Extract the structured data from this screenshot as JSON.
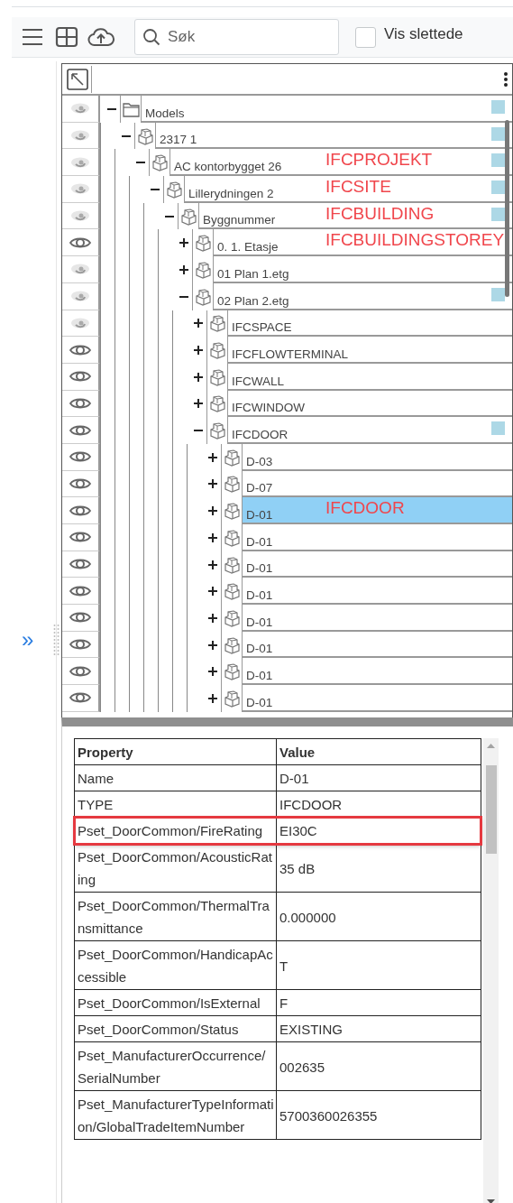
{
  "toolbar": {
    "search": {
      "placeholder": "Søk"
    },
    "show_deleted": {
      "label": "Vis slettede",
      "checked": false
    }
  },
  "sidebar": {
    "expand_glyph": "»"
  },
  "tree": {
    "nodes": [
      {
        "label": "Models",
        "kind": "folder",
        "dimmed": true,
        "expanded": true,
        "marker": true,
        "selected": false,
        "children": [
          {
            "label": "2317  1",
            "kind": "model",
            "dimmed": true,
            "expanded": true,
            "marker": true,
            "selected": false,
            "children": [
              {
                "label": "AC kontorbygget 26",
                "kind": "model",
                "dimmed": true,
                "expanded": true,
                "marker": true,
                "selected": false,
                "annotation": "IFCPROJEKT",
                "children": [
                  {
                    "label": "Lillerydningen 2",
                    "kind": "model",
                    "dimmed": true,
                    "expanded": true,
                    "marker": true,
                    "selected": false,
                    "annotation": "IFCSITE",
                    "children": [
                      {
                        "label": "Byggnummer",
                        "kind": "model",
                        "dimmed": true,
                        "expanded": true,
                        "marker": true,
                        "selected": false,
                        "annotation": "IFCBUILDING",
                        "children": [
                          {
                            "label": "0. 1. Etasje",
                            "kind": "model",
                            "dimmed": false,
                            "expanded": false,
                            "marker": false,
                            "selected": false,
                            "annotation": "IFCBUILDINGSTOREY"
                          },
                          {
                            "label": "01 Plan 1.etg",
                            "kind": "model",
                            "dimmed": true,
                            "expanded": false,
                            "marker": false,
                            "selected": false
                          },
                          {
                            "label": "02 Plan 2.etg",
                            "kind": "model",
                            "dimmed": true,
                            "expanded": true,
                            "marker": true,
                            "selected": false,
                            "children": [
                              {
                                "label": "IFCSPACE",
                                "kind": "model",
                                "dimmed": true,
                                "expanded": false,
                                "marker": false,
                                "selected": false
                              },
                              {
                                "label": "IFCFLOWTERMINAL",
                                "kind": "model",
                                "dimmed": false,
                                "expanded": false,
                                "marker": false,
                                "selected": false
                              },
                              {
                                "label": "IFCWALL",
                                "kind": "model",
                                "dimmed": false,
                                "expanded": false,
                                "marker": false,
                                "selected": false
                              },
                              {
                                "label": "IFCWINDOW",
                                "kind": "model",
                                "dimmed": false,
                                "expanded": false,
                                "marker": false,
                                "selected": false
                              },
                              {
                                "label": "IFCDOOR",
                                "kind": "model",
                                "dimmed": false,
                                "expanded": true,
                                "marker": true,
                                "selected": false,
                                "children": [
                                  {
                                    "label": "D-03",
                                    "kind": "model",
                                    "dimmed": false,
                                    "expanded": false,
                                    "marker": false,
                                    "selected": false
                                  },
                                  {
                                    "label": "D-07",
                                    "kind": "model",
                                    "dimmed": false,
                                    "expanded": false,
                                    "marker": false,
                                    "selected": false
                                  },
                                  {
                                    "label": "D-01",
                                    "kind": "model",
                                    "dimmed": false,
                                    "expanded": false,
                                    "marker": false,
                                    "selected": true,
                                    "annotation": "IFCDOOR"
                                  },
                                  {
                                    "label": "D-01",
                                    "kind": "model",
                                    "dimmed": false,
                                    "expanded": false,
                                    "marker": false,
                                    "selected": false
                                  },
                                  {
                                    "label": "D-01",
                                    "kind": "model",
                                    "dimmed": false,
                                    "expanded": false,
                                    "marker": false,
                                    "selected": false
                                  },
                                  {
                                    "label": "D-01",
                                    "kind": "model",
                                    "dimmed": false,
                                    "expanded": false,
                                    "marker": false,
                                    "selected": false
                                  },
                                  {
                                    "label": "D-01",
                                    "kind": "model",
                                    "dimmed": false,
                                    "expanded": false,
                                    "marker": false,
                                    "selected": false
                                  },
                                  {
                                    "label": "D-01",
                                    "kind": "model",
                                    "dimmed": false,
                                    "expanded": false,
                                    "marker": false,
                                    "selected": false
                                  },
                                  {
                                    "label": "D-01",
                                    "kind": "model",
                                    "dimmed": false,
                                    "expanded": false,
                                    "marker": false,
                                    "selected": false
                                  },
                                  {
                                    "label": "D-01",
                                    "kind": "model",
                                    "dimmed": false,
                                    "expanded": false,
                                    "marker": false,
                                    "selected": false
                                  }
                                ]
                              }
                            ]
                          }
                        ]
                      }
                    ]
                  }
                ]
              }
            ]
          }
        ]
      }
    ]
  },
  "properties": {
    "columns": [
      "Property",
      "Value"
    ],
    "rows": [
      {
        "property": "Name",
        "value": "D-01",
        "highlighted": false
      },
      {
        "property": "TYPE",
        "value": "IFCDOOR",
        "highlighted": false
      },
      {
        "property": "Pset_DoorCommon/FireRating",
        "value": "EI30C",
        "highlighted": true
      },
      {
        "property": "Pset_DoorCommon/AcousticRating",
        "value": "35 dB",
        "highlighted": false
      },
      {
        "property": "Pset_DoorCommon/ThermalTransmittance",
        "value": "0.000000",
        "highlighted": false
      },
      {
        "property": "Pset_DoorCommon/HandicapAccessible",
        "value": "T",
        "highlighted": false
      },
      {
        "property": "Pset_DoorCommon/IsExternal",
        "value": "F",
        "highlighted": false
      },
      {
        "property": "Pset_DoorCommon/Status",
        "value": "EXISTING",
        "highlighted": false
      },
      {
        "property": "Pset_ManufacturerOccurrence/SerialNumber",
        "value": "002635",
        "highlighted": false
      },
      {
        "property": "Pset_ManufacturerTypeInformation/GlobalTradeItemNumber",
        "value": "5700360026355",
        "highlighted": false
      }
    ]
  }
}
